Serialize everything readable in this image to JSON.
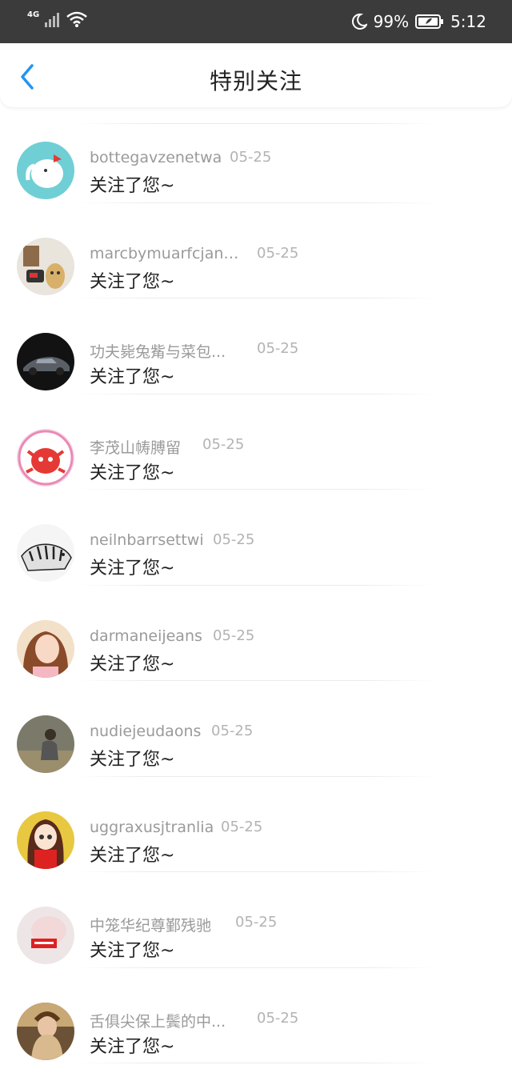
{
  "status_bar": {
    "network": "4G",
    "battery_percent": "99%",
    "time": "5:12",
    "icons": [
      "signal-icon",
      "wifi-icon",
      "moon-icon",
      "battery-icon"
    ]
  },
  "header": {
    "title": "特别关注",
    "back_icon": "chevron-left-icon",
    "accent_color": "#2196f3"
  },
  "items": [
    {
      "name": "bottegavzenetwa",
      "date": "05-25",
      "message": "关注了您~"
    },
    {
      "name": "marcbymuarfcjanc...",
      "date": "05-25",
      "message": "关注了您~"
    },
    {
      "name": "功夫毙兔觜与菜包...",
      "date": "05-25",
      "message": "关注了您~"
    },
    {
      "name": "李茂山帱膊留",
      "date": "05-25",
      "message": "关注了您~"
    },
    {
      "name": "neilnbarrsettwi",
      "date": "05-25",
      "message": "关注了您~"
    },
    {
      "name": "darmaneijeans",
      "date": "05-25",
      "message": "关注了您~"
    },
    {
      "name": "nudiejeudaons",
      "date": "05-25",
      "message": "关注了您~"
    },
    {
      "name": "uggraxusjtranlia",
      "date": "05-25",
      "message": "关注了您~"
    },
    {
      "name": "中笼华纪尊鄞残驰",
      "date": "05-25",
      "message": "关注了您~"
    },
    {
      "name": "舌俱尖保上鬓的中...",
      "date": "05-25",
      "message": "关注了您~"
    }
  ]
}
